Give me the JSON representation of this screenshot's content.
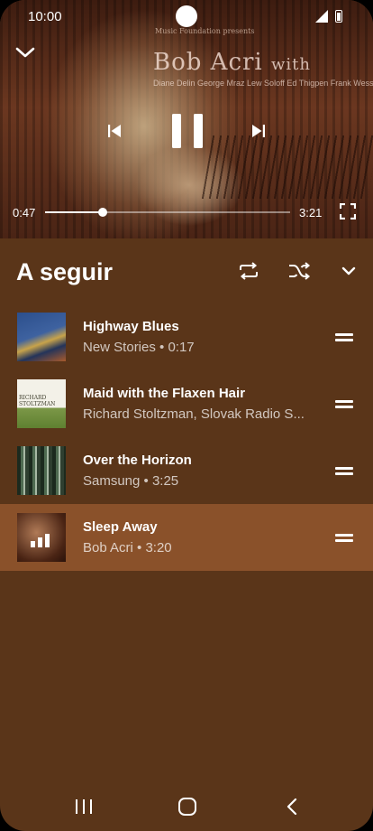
{
  "status_bar": {
    "time": "10:00",
    "icons": [
      "signal-icon",
      "battery-icon"
    ]
  },
  "video": {
    "album_art_text": {
      "caption": "Music Foundation presents",
      "artist": "Bob Acri",
      "artist_suffix": "with",
      "band": "Diane Delin  George Mraz  Lew Soloff  Ed Thigpen  Frank Wess"
    },
    "controls": {
      "collapse_icon": "chevron-down-icon",
      "previous_icon": "skip-previous-icon",
      "pause_icon": "pause-icon",
      "next_icon": "skip-next-icon",
      "fullscreen_icon": "fullscreen-icon"
    },
    "elapsed": "0:47",
    "total": "3:21",
    "progress": 0.234
  },
  "queue": {
    "title": "A seguir",
    "header_icons": [
      "repeat-icon",
      "shuffle-icon",
      "chevron-down-icon"
    ],
    "items": [
      {
        "title": "Highway Blues",
        "subtitle": "New Stories • 0:17",
        "current": false
      },
      {
        "title": "Maid with the Flaxen Hair",
        "subtitle": "Richard Stoltzman, Slovak Radio S...",
        "current": false
      },
      {
        "title": "Over the Horizon",
        "subtitle": "Samsung • 3:25",
        "current": false
      },
      {
        "title": "Sleep Away",
        "subtitle": "Bob Acri • 3:20",
        "current": true
      }
    ],
    "thumb_text": {
      "item2": "RICHARD STOLTZMAN"
    }
  },
  "colors": {
    "background": "#5a3519",
    "current_row": "#8a512a",
    "text": "#ffffff"
  },
  "nav_bar": {
    "icons": [
      "recents-icon",
      "home-icon",
      "back-icon"
    ]
  }
}
